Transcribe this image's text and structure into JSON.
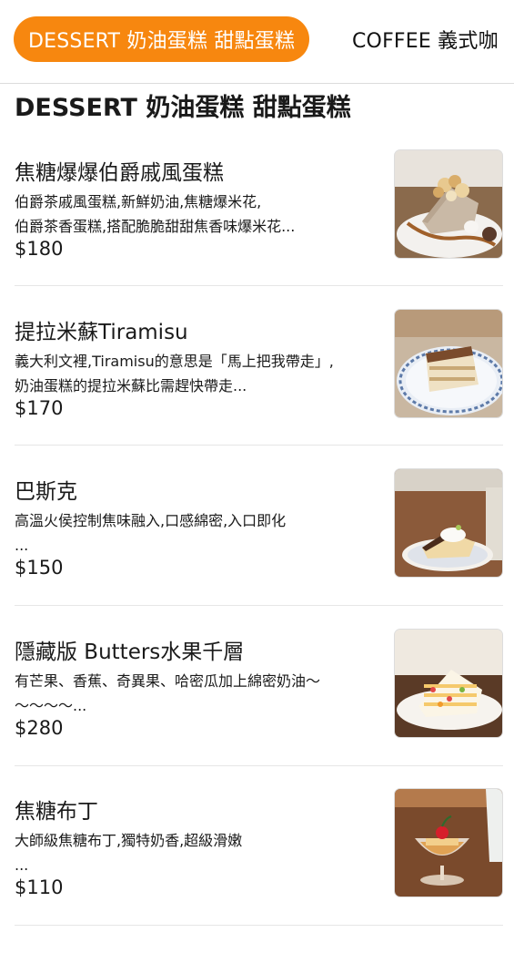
{
  "tabs": [
    {
      "label": "DESSERT 奶油蛋糕 甜點蛋糕",
      "active": true
    },
    {
      "label": "COFFEE 義式咖",
      "active": false
    }
  ],
  "section": {
    "title": "DESSERT 奶油蛋糕 甜點蛋糕"
  },
  "items": [
    {
      "name": "焦糖爆爆伯爵戚風蛋糕",
      "desc_lines": [
        "伯爵茶戚風蛋糕,新鮮奶油,焦糖爆米花,",
        "伯爵茶香蛋糕,搭配脆脆甜甜焦香味爆米花..."
      ],
      "price": "$180",
      "image": "caramel-popcorn-chiffon-cake-photo"
    },
    {
      "name": "提拉米蘇Tiramisu",
      "desc_lines": [
        "義大利文裡,Tiramisu的意思是「馬上把我帶走」,",
        "奶油蛋糕的提拉米蘇比需趕快帶走..."
      ],
      "price": "$170",
      "image": "tiramisu-photo"
    },
    {
      "name": "巴斯克",
      "desc_lines": [
        "高溫火侯控制焦味融入,口感綿密,入口即化",
        "..."
      ],
      "price": "$150",
      "image": "basque-cheesecake-photo"
    },
    {
      "name": "隱藏版 Butters水果千層",
      "desc_lines": [
        "有芒果、香蕉、奇異果、哈密瓜加上綿密奶油～",
        "～～～～..."
      ],
      "price": "$280",
      "image": "fruit-mille-crepe-photo"
    },
    {
      "name": "焦糖布丁",
      "desc_lines": [
        "大師級焦糖布丁,獨特奶香,超級滑嫩",
        "..."
      ],
      "price": "$110",
      "image": "caramel-pudding-photo"
    }
  ],
  "colors": {
    "accent": "#f7870f",
    "divider": "#e6e6e6",
    "text": "#1a1a1a"
  }
}
